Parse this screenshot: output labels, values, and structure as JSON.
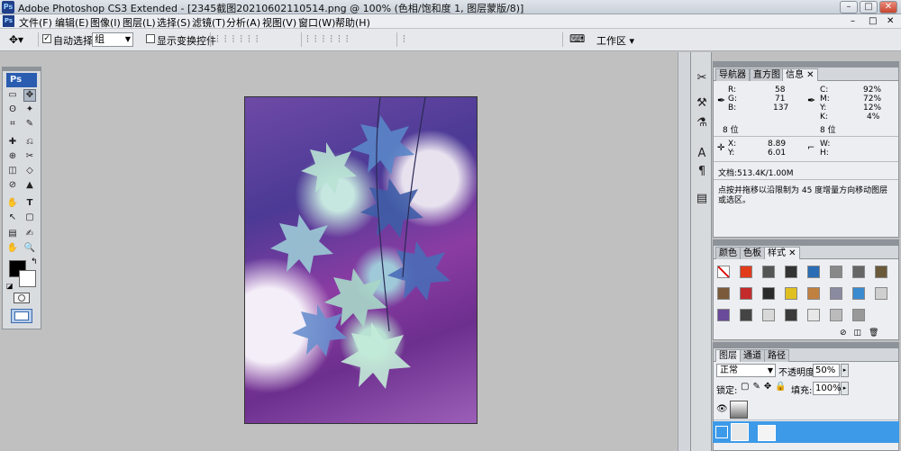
{
  "titlebar": {
    "app_icon": "ps-logo",
    "title": "Adobe Photoshop CS3 Extended - [2345截图20210602110514.png @ 100% (色相/饱和度 1, 图层蒙版/8)]",
    "min": "–",
    "max": "□",
    "close": "✕"
  },
  "menubar": {
    "logo": "Ps",
    "items": [
      "文件(F)",
      "编辑(E)",
      "图像(I)",
      "图层(L)",
      "选择(S)",
      "滤镜(T)",
      "分析(A)",
      "视图(V)",
      "窗口(W)",
      "帮助(H)"
    ],
    "doc_min": "–",
    "doc_max": "□",
    "doc_close": "✕"
  },
  "options": {
    "auto_select_label": "自动选择:",
    "auto_select_checked": true,
    "auto_select_value": "组",
    "show_transform_label": "显示变换控件",
    "show_transform_checked": false,
    "workspace_label": "工作区 ▾"
  },
  "toolbox": {
    "badge": "Ps",
    "tools": [
      [
        "▭",
        "✥"
      ],
      [
        "ʘ",
        "✦"
      ],
      [
        "⌗",
        "✎"
      ],
      [
        "✚",
        "⎌"
      ],
      [
        "⊕",
        "✂"
      ],
      [
        "◫",
        "◇"
      ],
      [
        "⊘",
        "▲"
      ],
      [
        "✋",
        "✒"
      ],
      [
        "T",
        "↖"
      ],
      [
        "◐",
        "▢"
      ],
      [
        "▤",
        "✍"
      ],
      [
        "✋",
        "🔍"
      ]
    ]
  },
  "info_panel": {
    "tabs": [
      "导航器",
      "直方图",
      "信息"
    ],
    "active_tab": "信息",
    "R_label": "R:",
    "R_val": "58",
    "G_label": "G:",
    "G_val": "71",
    "B_label": "B:",
    "B_val": "137",
    "C_label": "C:",
    "C_val": "92%",
    "M_label": "M:",
    "M_val": "72%",
    "Y_label": "Y:",
    "Y_val": "12%",
    "K_label": "K:",
    "K_val": "4%",
    "bits_left": "8 位",
    "bits_right": "8 位",
    "X_label": "X:",
    "X_val": "8.89",
    "Yc_label": "Y:",
    "Yc_val": "6.01",
    "W_label": "W:",
    "H_label": "H:",
    "doc_label": "文档:513.4K/1.00M",
    "hint": "点按并拖移以沿限制为 45 度增量方向移动图层或选区。"
  },
  "styles_panel": {
    "tabs": [
      "颜色",
      "色板",
      "样式"
    ],
    "active_tab": "样式",
    "swatch_colors": [
      "#ffffff",
      "#e23b1a",
      "#555555",
      "#333333",
      "#2a6db5",
      "#888888",
      "#666666",
      "#6b5a3a",
      "#7a5a3a",
      "#c42a2a",
      "#2a2a2a",
      "#e0c020",
      "#c08040",
      "#8a8aa0",
      "#3a8ad0",
      "#cfcfcf",
      "#6a4a9a",
      "#444444",
      "#d8d8d8",
      "#3a3a3a",
      "#e8e8e8",
      "#bbbbbb",
      "#999999"
    ]
  },
  "layers_panel": {
    "tabs": [
      "图层",
      "通道",
      "路径"
    ],
    "active_tab": "图层",
    "blend_mode": "正常",
    "opacity_label": "不透明度:",
    "opacity_value": "50%",
    "lock_label": "锁定:",
    "fill_label": "填充:",
    "fill_value": "100%"
  }
}
